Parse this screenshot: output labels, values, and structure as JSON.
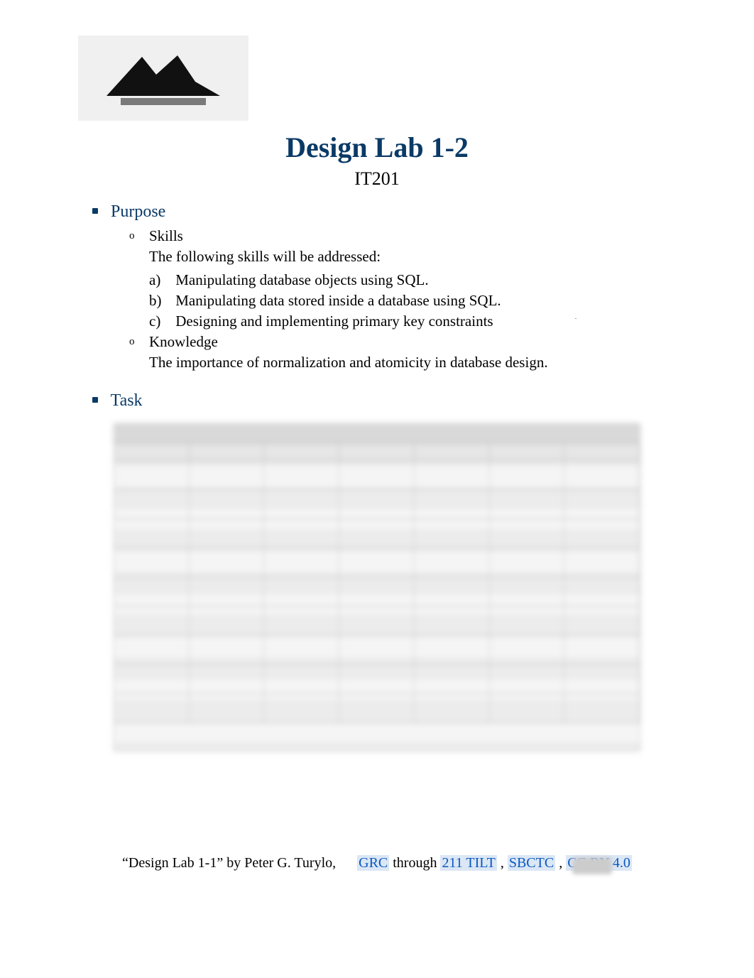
{
  "doc": {
    "title": "Design Lab 1-2",
    "subtitle": "IT201"
  },
  "sections": {
    "purpose": {
      "heading": "Purpose",
      "skills": {
        "label": "Skills",
        "intro": "The following skills will be addressed:",
        "items": [
          "Manipulating database objects using SQL.",
          "Manipulating data stored inside a database using SQL.",
          "Designing and implementing primary key constraints"
        ]
      },
      "knowledge": {
        "label": "Knowledge",
        "text": "The importance of normalization and atomicity in database design."
      }
    },
    "task": {
      "heading": "Task"
    }
  },
  "ordered_markers": [
    "a)",
    "b)",
    "c)"
  ],
  "footer": {
    "prefix": "“Design Lab 1-1” by Peter G. Turylo,",
    "link1": "GRC",
    "mid1": " through  ",
    "link2": "211 TILT",
    "mid2": " , ",
    "link3": "SBCTC",
    "mid3": ", ",
    "link4": "CC BY 4.0"
  }
}
